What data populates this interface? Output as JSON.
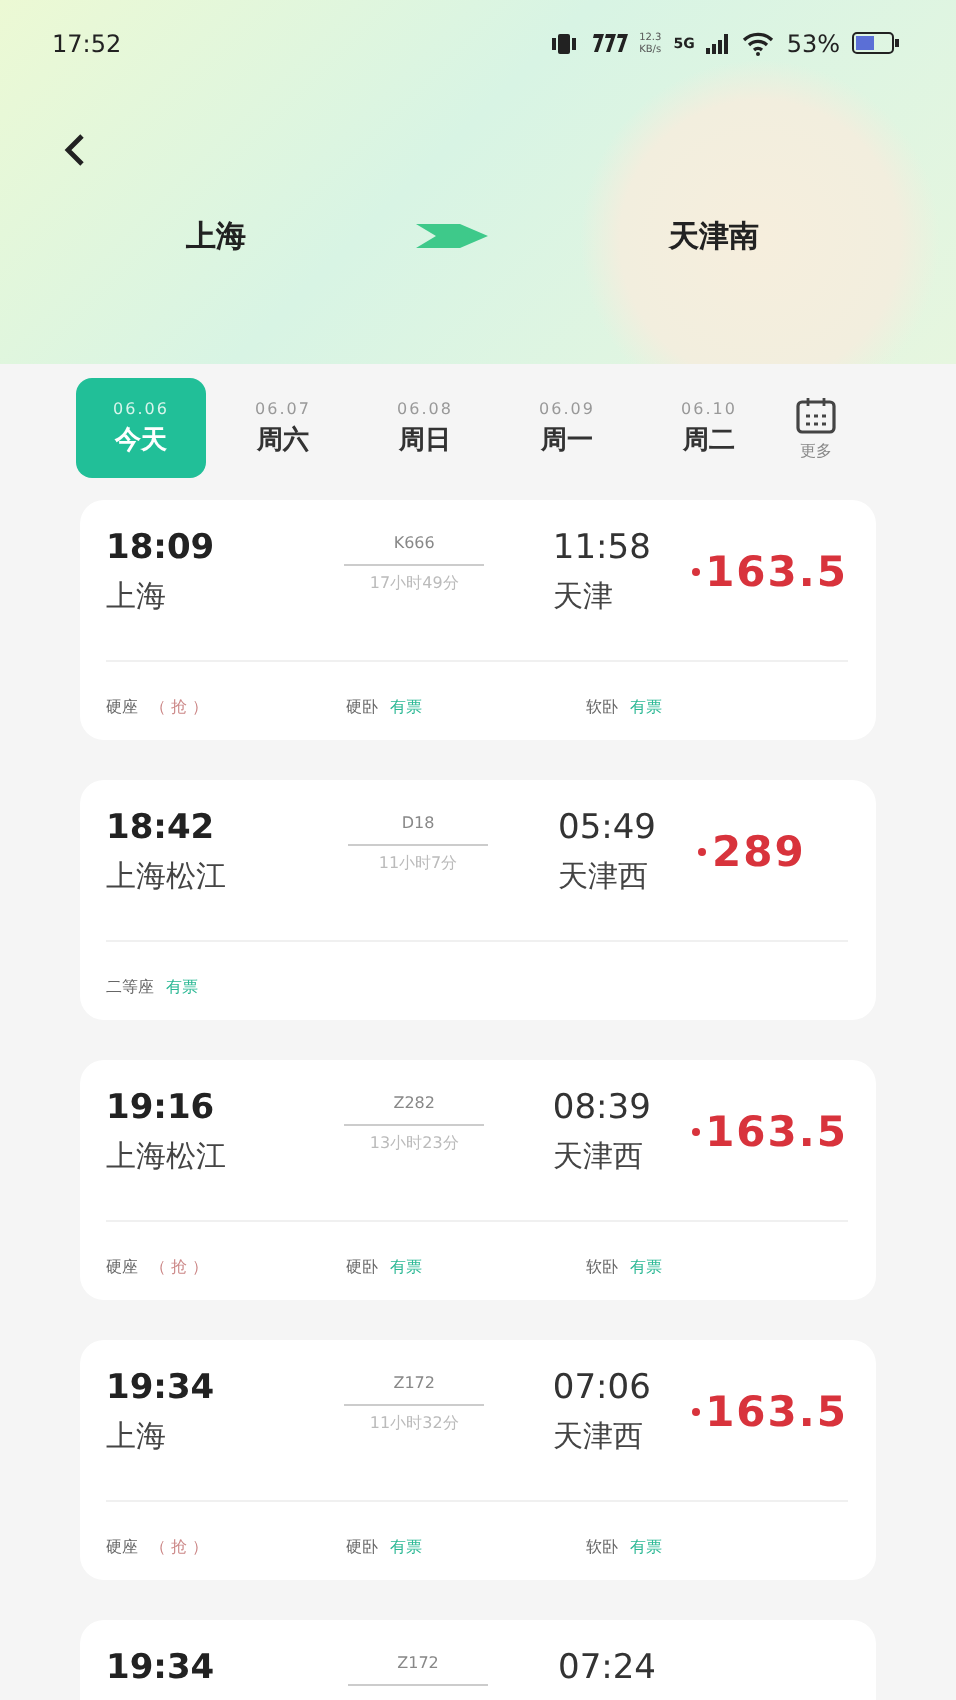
{
  "status_bar": {
    "time": "17:52",
    "speed": "12.3",
    "speed_unit": "KB/s",
    "network": "5G",
    "battery": "53%"
  },
  "route": {
    "from": "上海",
    "to": "天津南"
  },
  "dates": [
    {
      "date": "06.06",
      "label": "今天",
      "selected": true
    },
    {
      "date": "06.07",
      "label": "周六",
      "selected": false
    },
    {
      "date": "06.08",
      "label": "周日",
      "selected": false
    },
    {
      "date": "06.09",
      "label": "周一",
      "selected": false
    },
    {
      "date": "06.10",
      "label": "周二",
      "selected": false
    }
  ],
  "more": "更多",
  "trains": [
    {
      "depart": "18:09",
      "from": "上海",
      "number": "K666",
      "duration": "17小时49分",
      "arrive": "11:58",
      "to": "天津",
      "price": "163.5",
      "seats": [
        {
          "name": "硬座",
          "status": "（ 抢 ）",
          "kind": "grab"
        },
        {
          "name": "硬卧",
          "status": "有票",
          "kind": "available"
        },
        {
          "name": "软卧",
          "status": "有票",
          "kind": "available"
        }
      ]
    },
    {
      "depart": "18:42",
      "from": "上海松江",
      "number": "D18",
      "duration": "11小时7分",
      "arrive": "05:49",
      "to": "天津西",
      "price": "289",
      "seats": [
        {
          "name": "二等座",
          "status": "有票",
          "kind": "available"
        }
      ]
    },
    {
      "depart": "19:16",
      "from": "上海松江",
      "number": "Z282",
      "duration": "13小时23分",
      "arrive": "08:39",
      "to": "天津西",
      "price": "163.5",
      "seats": [
        {
          "name": "硬座",
          "status": "（ 抢 ）",
          "kind": "grab"
        },
        {
          "name": "硬卧",
          "status": "有票",
          "kind": "available"
        },
        {
          "name": "软卧",
          "status": "有票",
          "kind": "available"
        }
      ]
    },
    {
      "depart": "19:34",
      "from": "上海",
      "number": "Z172",
      "duration": "11小时32分",
      "arrive": "07:06",
      "to": "天津西",
      "price": "163.5",
      "seats": [
        {
          "name": "硬座",
          "status": "（ 抢 ）",
          "kind": "grab"
        },
        {
          "name": "硬卧",
          "status": "有票",
          "kind": "available"
        },
        {
          "name": "软卧",
          "status": "有票",
          "kind": "available"
        }
      ]
    },
    {
      "depart": "19:34",
      "number": "Z172",
      "arrive": "07:24"
    }
  ]
}
